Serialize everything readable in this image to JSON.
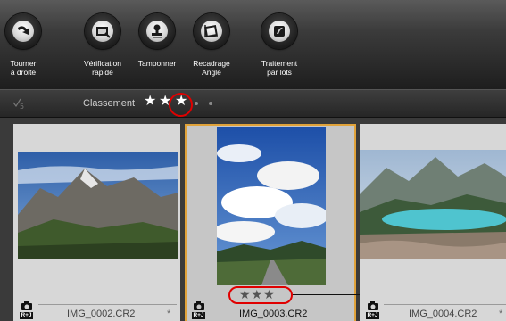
{
  "toolbar": {
    "buttons": [
      {
        "label": "Tourner\nà droite",
        "icon": "rotate-right-icon"
      },
      {
        "label": "Vérification\nrapide",
        "icon": "quick-check-icon"
      },
      {
        "label": "Tamponner",
        "icon": "stamp-icon"
      },
      {
        "label": "Recadrage\nAngle",
        "icon": "crop-angle-icon"
      },
      {
        "label": "Traitement\npar lots",
        "icon": "batch-process-icon"
      }
    ]
  },
  "filter": {
    "label": "Classement",
    "stars": [
      "★",
      "★",
      "★"
    ],
    "selected_rating": 3
  },
  "thumbnails": [
    {
      "filename": "IMG_0002.CR2",
      "selected": false,
      "raw_jpeg_badge": "R+J",
      "asterisk": "*"
    },
    {
      "filename": "IMG_0003.CR2",
      "selected": true,
      "raw_jpeg_badge": "R+J",
      "rating": "★★★"
    },
    {
      "filename": "IMG_0004.CR2",
      "selected": false,
      "raw_jpeg_badge": "R+J",
      "asterisk": "*"
    }
  ],
  "colors": {
    "highlight": "#e00000",
    "selection_border": "#e0a23a"
  }
}
